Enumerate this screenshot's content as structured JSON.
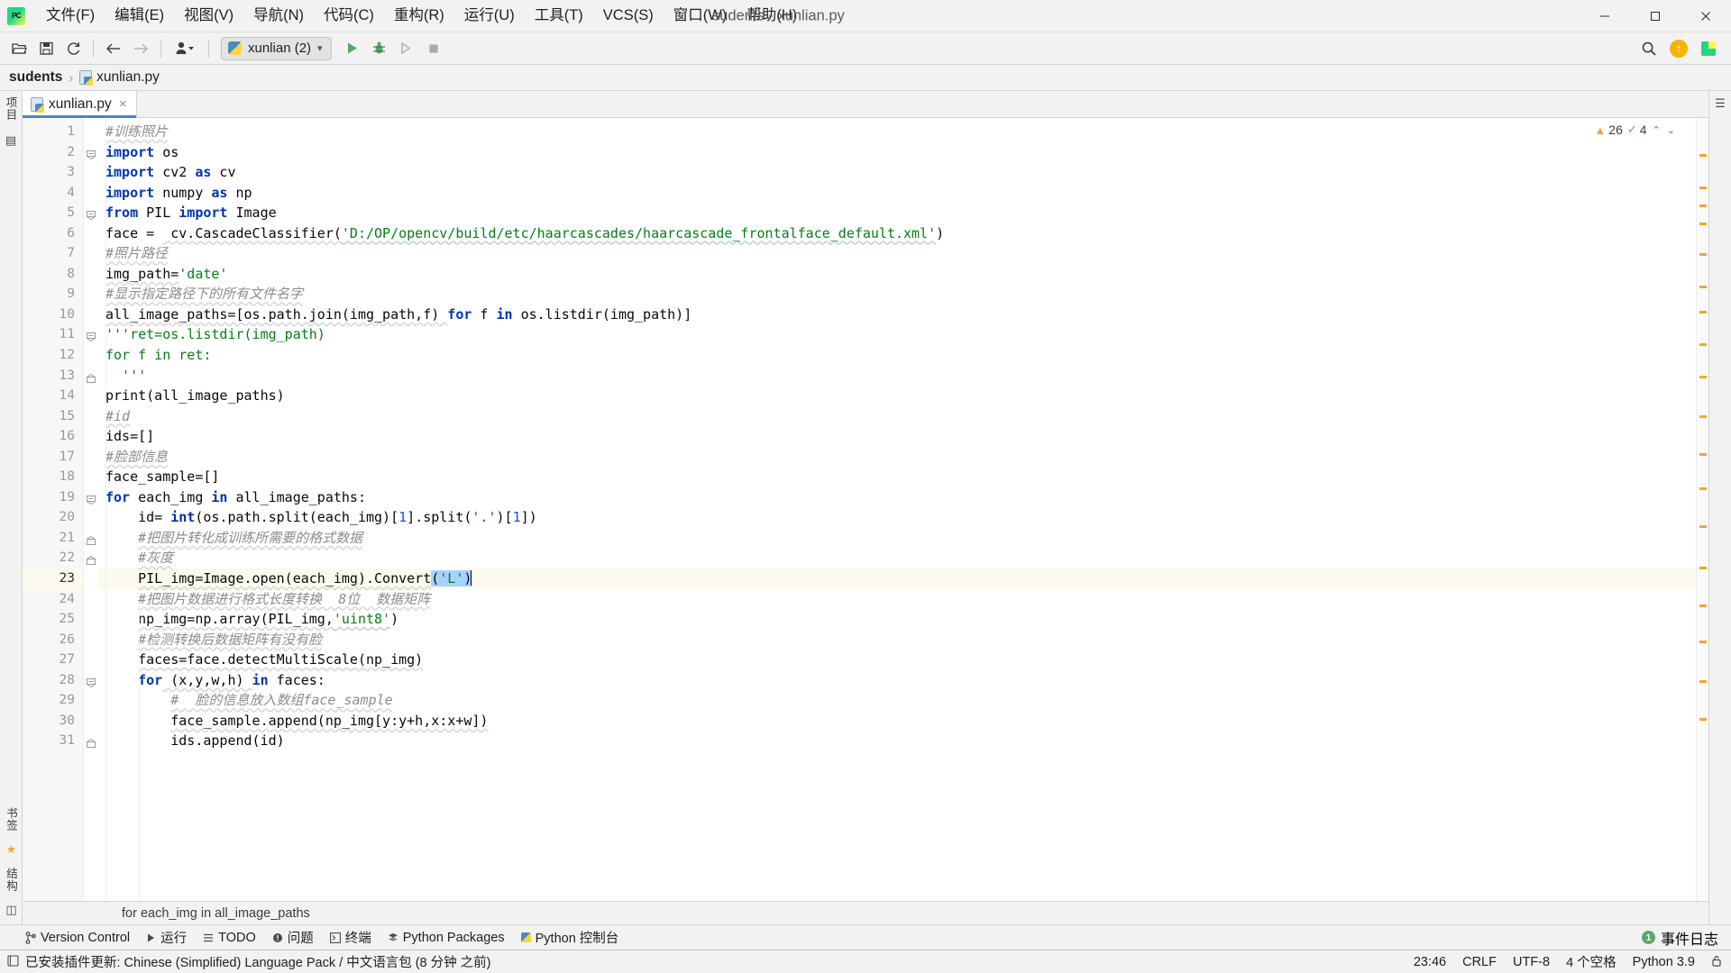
{
  "window": {
    "title": "sudents - xunlian.py",
    "logo_text": "PC",
    "controls": {
      "minimize": "minimize-icon",
      "maximize": "maximize-icon",
      "close": "close-icon"
    }
  },
  "menu": [
    {
      "label": "文件(F)"
    },
    {
      "label": "编辑(E)"
    },
    {
      "label": "视图(V)"
    },
    {
      "label": "导航(N)"
    },
    {
      "label": "代码(C)"
    },
    {
      "label": "重构(R)"
    },
    {
      "label": "运行(U)"
    },
    {
      "label": "工具(T)"
    },
    {
      "label": "VCS(S)"
    },
    {
      "label": "窗口(W)"
    },
    {
      "label": "帮助(H)"
    }
  ],
  "toolbar": {
    "open_icon": "folder-open-icon",
    "save_icon": "save-icon",
    "sync_icon": "refresh-icon",
    "back_icon": "arrow-left-icon",
    "forward_icon": "arrow-right-icon",
    "profile_icon": "user-icon",
    "run_config": "xunlian (2)",
    "run_icon": "run-icon",
    "debug_icon": "debug-icon",
    "coverage_icon": "run-coverage-icon",
    "stop_icon": "stop-icon",
    "search_icon": "search-icon",
    "update_icon": "update-available-icon",
    "ide_icon": "ide-icon"
  },
  "breadcrumb": {
    "project": "sudents",
    "separator": "›",
    "file": "xunlian.py"
  },
  "tabs": [
    {
      "label": "xunlian.py",
      "close": "×",
      "active": true
    }
  ],
  "left_rail": {
    "project_label": "项目",
    "structure_label": "结构",
    "bookmarks_label": "书签",
    "favorites_label": "收藏夹"
  },
  "inspection": {
    "warning_icon": "warning-triangle-icon",
    "warning_count": "26",
    "ok_icon": "check-icon",
    "ok_count": "4",
    "up_arrow": "⌃",
    "down_arrow": "⌄"
  },
  "editor": {
    "current_line": 23,
    "lines": [
      {
        "n": 1,
        "indent": 0,
        "tokens": [
          {
            "t": "#训练照片",
            "c": "cmt sq"
          }
        ]
      },
      {
        "n": 2,
        "indent": 0,
        "fold": "minus",
        "tokens": [
          {
            "t": "import",
            "c": "kw"
          },
          {
            "t": " os",
            "c": ""
          }
        ]
      },
      {
        "n": 3,
        "indent": 0,
        "tokens": [
          {
            "t": "import",
            "c": "kw"
          },
          {
            "t": " cv2 ",
            "c": ""
          },
          {
            "t": "as",
            "c": "kw"
          },
          {
            "t": " cv",
            "c": ""
          }
        ]
      },
      {
        "n": 4,
        "indent": 0,
        "tokens": [
          {
            "t": "import",
            "c": "kw"
          },
          {
            "t": " numpy ",
            "c": ""
          },
          {
            "t": "as",
            "c": "kw"
          },
          {
            "t": " np",
            "c": ""
          }
        ]
      },
      {
        "n": 5,
        "indent": 0,
        "fold": "minus",
        "tokens": [
          {
            "t": "from",
            "c": "kw"
          },
          {
            "t": " PIL ",
            "c": ""
          },
          {
            "t": "import",
            "c": "kw"
          },
          {
            "t": " Image",
            "c": ""
          }
        ]
      },
      {
        "n": 6,
        "indent": 0,
        "tokens": [
          {
            "t": "face = ",
            "c": ""
          },
          {
            "t": " cv.CascadeClassifier(",
            "c": "sq"
          },
          {
            "t": "'D:/OP/opencv/build/etc/haarcascades/haarcascade_frontalface_default.xml'",
            "c": "str sqg"
          },
          {
            "t": ")",
            "c": ""
          }
        ]
      },
      {
        "n": 7,
        "indent": 0,
        "tokens": [
          {
            "t": "#照片路径",
            "c": "cmt sq"
          }
        ]
      },
      {
        "n": 8,
        "indent": 0,
        "tokens": [
          {
            "t": "img_path=",
            "c": "sq"
          },
          {
            "t": "'date'",
            "c": "str"
          }
        ]
      },
      {
        "n": 9,
        "indent": 0,
        "tokens": [
          {
            "t": "#显示指定路径下的所有文件名字",
            "c": "cmt sq"
          }
        ]
      },
      {
        "n": 10,
        "indent": 0,
        "tokens": [
          {
            "t": "all_image_paths=[os.path.join(img_path,f) ",
            "c": "sq"
          },
          {
            "t": "for",
            "c": "kw"
          },
          {
            "t": " f ",
            "c": ""
          },
          {
            "t": "in",
            "c": "kw"
          },
          {
            "t": " os.listdir(img_path)]",
            "c": ""
          }
        ]
      },
      {
        "n": 11,
        "indent": 0,
        "fold": "minus",
        "tokens": [
          {
            "t": "'''ret=os.listdir(img_path)",
            "c": "str"
          }
        ]
      },
      {
        "n": 12,
        "indent": 0,
        "tokens": [
          {
            "t": "for f in ret:",
            "c": "str"
          }
        ]
      },
      {
        "n": 13,
        "indent": 0,
        "fold": "end",
        "tokens": [
          {
            "t": "  '''",
            "c": "str"
          }
        ]
      },
      {
        "n": 14,
        "indent": 0,
        "tokens": [
          {
            "t": "print(all_image_paths)",
            "c": ""
          }
        ]
      },
      {
        "n": 15,
        "indent": 0,
        "tokens": [
          {
            "t": "#id",
            "c": "cmt sq"
          }
        ]
      },
      {
        "n": 16,
        "indent": 0,
        "tokens": [
          {
            "t": "ids=[]",
            "c": ""
          }
        ]
      },
      {
        "n": 17,
        "indent": 0,
        "tokens": [
          {
            "t": "#脸部信息",
            "c": "cmt sq"
          }
        ]
      },
      {
        "n": 18,
        "indent": 0,
        "tokens": [
          {
            "t": "face_sample=[]",
            "c": ""
          }
        ]
      },
      {
        "n": 19,
        "indent": 0,
        "fold": "minus",
        "tokens": [
          {
            "t": "for",
            "c": "kw"
          },
          {
            "t": " each_img ",
            "c": ""
          },
          {
            "t": "in",
            "c": "kw"
          },
          {
            "t": " all_image_paths:",
            "c": ""
          }
        ]
      },
      {
        "n": 20,
        "indent": 1,
        "tokens": [
          {
            "t": "id= ",
            "c": ""
          },
          {
            "t": "int",
            "c": "kw"
          },
          {
            "t": "(os.path.split(each_img)[",
            "c": ""
          },
          {
            "t": "1",
            "c": "num"
          },
          {
            "t": "].split(",
            "c": ""
          },
          {
            "t": "'.'",
            "c": "str"
          },
          {
            "t": ")[",
            "c": ""
          },
          {
            "t": "1",
            "c": "num"
          },
          {
            "t": "])",
            "c": ""
          }
        ]
      },
      {
        "n": 21,
        "indent": 1,
        "fold": "end",
        "tokens": [
          {
            "t": "#把图片转化成训练所需要的格式数据",
            "c": "cmt sq"
          }
        ]
      },
      {
        "n": 22,
        "indent": 1,
        "fold": "end",
        "tokens": [
          {
            "t": "#灰度",
            "c": "cmt sq"
          }
        ]
      },
      {
        "n": 23,
        "indent": 1,
        "current": true,
        "tokens": [
          {
            "t": "PIL_img=Image.open(each_img).Convert",
            "c": "sq"
          },
          {
            "t": "(",
            "c": "sel"
          },
          {
            "t": "'L'",
            "c": "str sel"
          },
          {
            "t": ")",
            "c": "sel"
          },
          {
            "t": "|",
            "c": "caret"
          }
        ]
      },
      {
        "n": 24,
        "indent": 1,
        "tokens": [
          {
            "t": "#把图片数据进行格式长度转换  8位  数据矩阵",
            "c": "cmt sq"
          }
        ]
      },
      {
        "n": 25,
        "indent": 1,
        "tokens": [
          {
            "t": "np_img=np.array(PIL_img,",
            "c": "sq"
          },
          {
            "t": "'uint8'",
            "c": "str sqg"
          },
          {
            "t": ")",
            "c": ""
          }
        ]
      },
      {
        "n": 26,
        "indent": 1,
        "tokens": [
          {
            "t": "#检测转换后数据矩阵有没有脸",
            "c": "cmt sq"
          }
        ]
      },
      {
        "n": 27,
        "indent": 1,
        "tokens": [
          {
            "t": "faces=face.detectMultiScale(np_img)",
            "c": "sq"
          }
        ]
      },
      {
        "n": 28,
        "indent": 1,
        "fold": "minus",
        "tokens": [
          {
            "t": "for",
            "c": "kw"
          },
          {
            "t": " (x,y,w,h) ",
            "c": "sq"
          },
          {
            "t": "in",
            "c": "kw"
          },
          {
            "t": " faces:",
            "c": ""
          }
        ]
      },
      {
        "n": 29,
        "indent": 2,
        "tokens": [
          {
            "t": "#  脸的信息放入数组face_sample",
            "c": "cmt sq"
          }
        ]
      },
      {
        "n": 30,
        "indent": 2,
        "tokens": [
          {
            "t": "face_sample.append(np_img[y:y+h,x:x+w])",
            "c": "sq"
          }
        ]
      },
      {
        "n": 31,
        "indent": 2,
        "fold": "end",
        "tokens": [
          {
            "t": "ids.append(id)",
            "c": ""
          }
        ]
      }
    ]
  },
  "context_strip": {
    "text": "for each_img in all_image_paths"
  },
  "tool_window_bar": {
    "items": [
      {
        "label": "Version Control",
        "icon": "branch-icon"
      },
      {
        "label": "运行",
        "icon": "run-icon"
      },
      {
        "label": "TODO",
        "icon": "todo-icon"
      },
      {
        "label": "问题",
        "icon": "problems-icon"
      },
      {
        "label": "终端",
        "icon": "terminal-icon"
      },
      {
        "label": "Python Packages",
        "icon": "packages-icon"
      },
      {
        "label": "Python 控制台",
        "icon": "python-console-icon"
      }
    ],
    "event_log": {
      "count": "1",
      "label": "事件日志"
    }
  },
  "status_bar": {
    "notification_icon": "notification-icon",
    "message": "已安装插件更新: Chinese (Simplified) Language Pack / 中文语言包 (8 分钟 之前)",
    "position": "23:46",
    "line_separator": "CRLF",
    "encoding": "UTF-8",
    "indent": "4 个空格",
    "interpreter": "Python 3.9",
    "lock_icon": "lock-icon"
  },
  "colors": {
    "keyword": "#0033b3",
    "string": "#067d17",
    "number": "#1750eb",
    "comment": "#8c8c8c",
    "selection": "#a6d2ff",
    "current_line": "#fcfaed",
    "tab_underline": "#4a86c7",
    "accent_green": "#59a869",
    "warning": "#f0a732"
  }
}
